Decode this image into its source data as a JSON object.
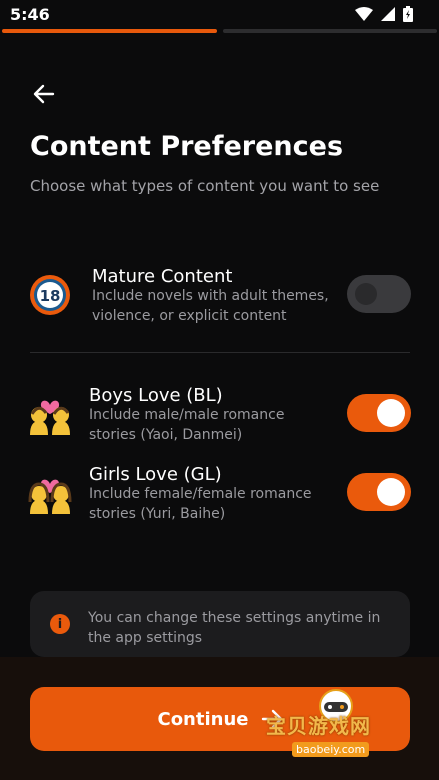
{
  "status": {
    "time": "5:46"
  },
  "progress": {
    "steps_total": 2,
    "steps_done": 1
  },
  "page": {
    "title": "Content Preferences",
    "subtitle": "Choose what types of content you want to see"
  },
  "options": [
    {
      "icon_text": "18",
      "label": "Mature Content",
      "description": "Include novels with adult themes, violence, or explicit content",
      "enabled": false
    },
    {
      "icon": "couple-heart-icon",
      "label": "Boys Love (BL)",
      "description": "Include male/male romance stories (Yaoi, Danmei)",
      "enabled": true
    },
    {
      "icon": "couple-heart-icon",
      "label": "Girls Love (GL)",
      "description": "Include female/female romance stories (Yuri, Baihe)",
      "enabled": true
    }
  ],
  "info": {
    "text": "You can change these settings anytime in the app settings"
  },
  "actions": {
    "continue_label": "Continue"
  },
  "watermark": {
    "text": "宝贝游戏网",
    "url": "baobeiy.com"
  },
  "colors": {
    "accent": "#e8590c",
    "background": "#0b0b0c",
    "toggle_off": "#3a3a3d"
  }
}
